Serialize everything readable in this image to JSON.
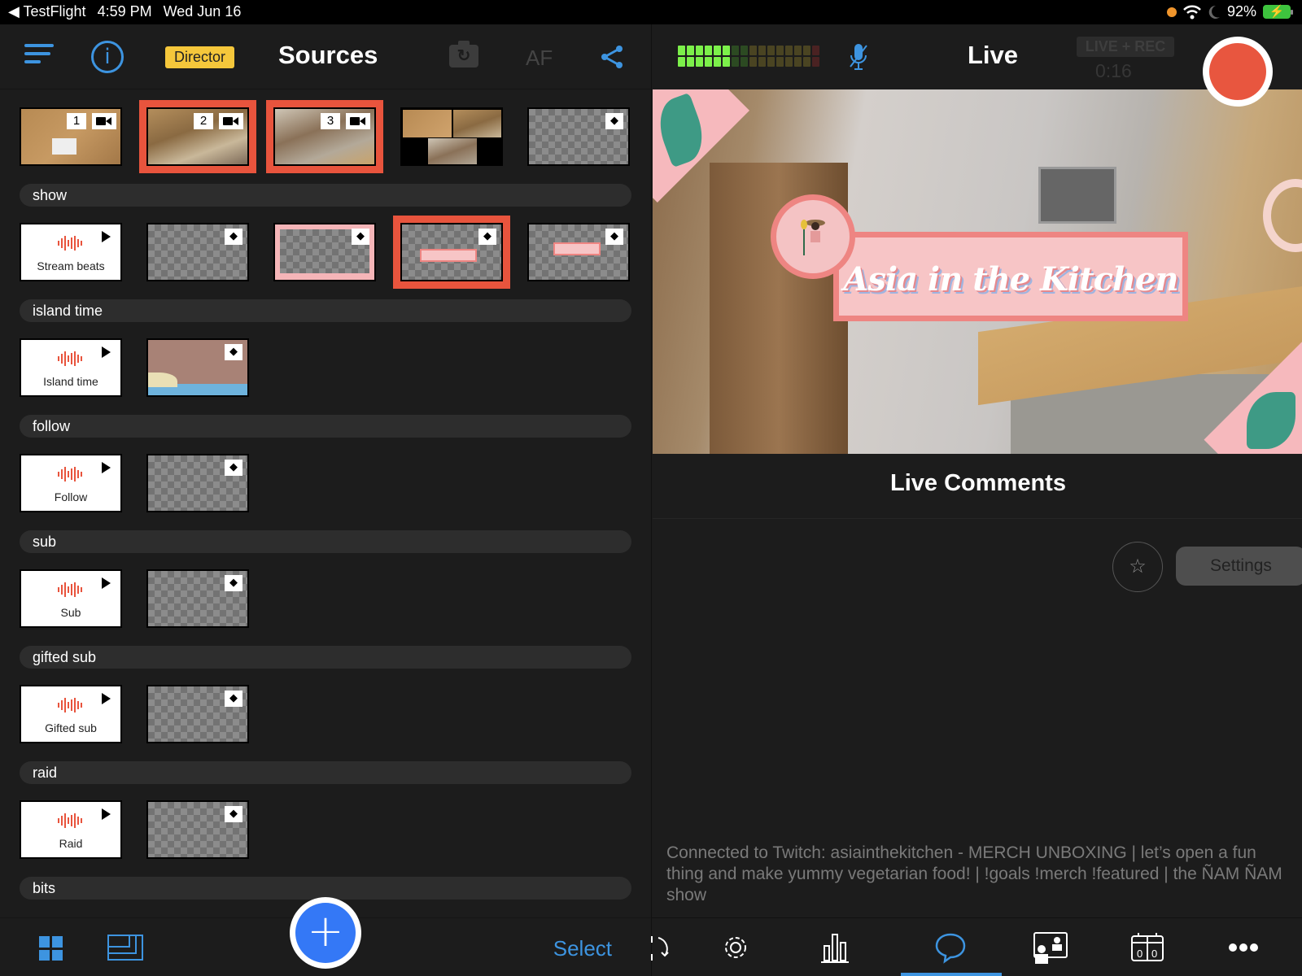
{
  "status_bar": {
    "back_app": "TestFlight",
    "time": "4:59 PM",
    "date": "Wed Jun 16",
    "battery": "92%",
    "icons": [
      "orange-dot-indicator",
      "wifi-icon",
      "moon-icon",
      "battery-charging-icon"
    ]
  },
  "left_header": {
    "menu_icon": "hamburger-icon",
    "info_icon": "info-icon",
    "mode_badge": "Director",
    "title": "Sources",
    "camera_flip_icon": "camera-rotate-icon",
    "af_label": "AF",
    "share_icon": "share-icon"
  },
  "top_sources": [
    {
      "type": "camera",
      "number": "1",
      "selected": false
    },
    {
      "type": "camera",
      "number": "2",
      "selected": true
    },
    {
      "type": "camera",
      "number": "3",
      "selected": true
    },
    {
      "type": "multiview",
      "selected": false
    },
    {
      "type": "layer-overlay",
      "selected": false
    }
  ],
  "groups": [
    {
      "name": "show",
      "items": [
        {
          "type": "audio",
          "label": "Stream beats"
        },
        {
          "type": "layer-overlay",
          "selected": false
        },
        {
          "type": "layer-overlay",
          "style": "pink-frame",
          "selected": false
        },
        {
          "type": "layer-overlay",
          "style": "title-banner",
          "selected": true
        },
        {
          "type": "layer-overlay",
          "style": "brb-banner",
          "selected": false
        }
      ]
    },
    {
      "name": "island time",
      "items": [
        {
          "type": "audio",
          "label": "Island time"
        },
        {
          "type": "layer-overlay",
          "style": "island"
        }
      ]
    },
    {
      "name": "follow",
      "items": [
        {
          "type": "audio",
          "label": "Follow"
        },
        {
          "type": "layer-overlay"
        }
      ]
    },
    {
      "name": "sub",
      "items": [
        {
          "type": "audio",
          "label": "Sub"
        },
        {
          "type": "layer-overlay"
        }
      ]
    },
    {
      "name": "gifted sub",
      "items": [
        {
          "type": "audio",
          "label": "Gifted sub"
        },
        {
          "type": "layer-overlay"
        }
      ]
    },
    {
      "name": "raid",
      "items": [
        {
          "type": "audio",
          "label": "Raid"
        },
        {
          "type": "layer-overlay"
        }
      ]
    },
    {
      "name": "bits",
      "items": []
    }
  ],
  "left_bottom": {
    "grid_view_icon": "grid-icon",
    "layout_icon": "layout-icon",
    "add_icon": "plus-icon",
    "select_label": "Select"
  },
  "right_header": {
    "title": "Live",
    "mode_label": "LIVE + REC",
    "timer": "0:16",
    "audio_meter_level": 0.375,
    "mic_icon": "mic-muted-icon",
    "record_icon": "record-button"
  },
  "preview": {
    "overlay_title": "Asia in the Kitchen"
  },
  "comments": {
    "title": "Live Comments",
    "star_icon": "star-icon",
    "settings_label": "Settings",
    "status_message": "Connected to Twitch: asiainthekitchen - MERCH UNBOXING | let’s open a fun thing and make yummy vegetarian food! | !goals !merch !featured | the ÑAM ÑAM show"
  },
  "right_tabs": [
    {
      "icon": "switch-icon",
      "active": false
    },
    {
      "icon": "gear-icon",
      "active": false
    },
    {
      "icon": "stats-icon",
      "active": false
    },
    {
      "icon": "comment-icon",
      "active": true
    },
    {
      "icon": "guests-icon",
      "active": false
    },
    {
      "icon": "scoreboard-icon",
      "active": false
    },
    {
      "icon": "more-icon",
      "active": false
    }
  ],
  "colors": {
    "accent": "#3d94e0",
    "record": "#e8563f",
    "selected_outline": "#e8543d",
    "director_badge": "#f5c73b"
  }
}
